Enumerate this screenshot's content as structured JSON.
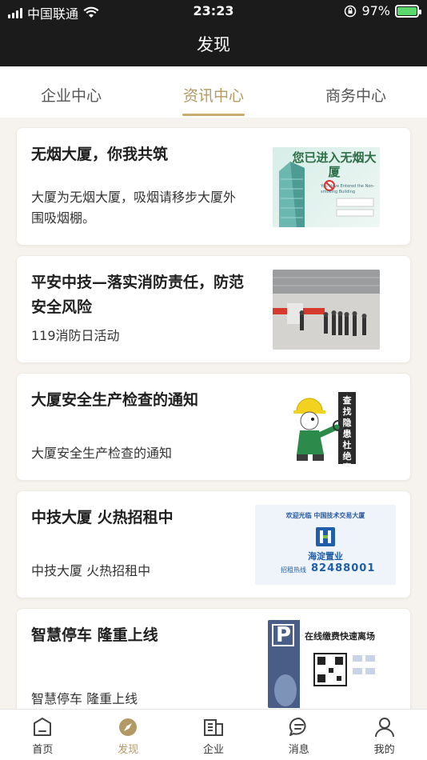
{
  "status": {
    "carrier": "中国联通",
    "time": "23:23",
    "battery_pct": "97%"
  },
  "nav": {
    "title": "发现"
  },
  "tabs": [
    {
      "label": "企业中心",
      "active": false
    },
    {
      "label": "资讯中心",
      "active": true
    },
    {
      "label": "商务中心",
      "active": false
    }
  ],
  "articles": [
    {
      "title": "无烟大厦，你我共筑",
      "desc": "大厦为无烟大厦，吸烟请移步大厦外围吸烟棚。",
      "thumb_text": "您已进入无烟大厦",
      "thumb_sub": "You Have Entered the Non-smoking Building"
    },
    {
      "title": "平安中技—落实消防责任，防范安全风险",
      "desc": "119消防日活动"
    },
    {
      "title": "大厦安全生产检查的通知",
      "desc": "大厦安全生产检查的通知",
      "thumb_text": "查找隐患杜绝事故"
    },
    {
      "title": "中技大厦 火热招租中",
      "desc": "中技大厦 火热招租中",
      "thumb_text": "欢迎光临 中国技术交易大厦",
      "thumb_brand": "海淀置业",
      "thumb_hotline_label": "招租热线",
      "thumb_hotline": "82488001"
    },
    {
      "title": "智慧停车 隆重上线",
      "desc": "智慧停车 隆重上线",
      "thumb_text": "在线缴费快速离场",
      "thumb_letter": "P"
    }
  ],
  "tabbar": [
    {
      "label": "首页",
      "icon": "home-icon",
      "active": false
    },
    {
      "label": "发现",
      "icon": "compass-icon",
      "active": true
    },
    {
      "label": "企业",
      "icon": "building-icon",
      "active": false
    },
    {
      "label": "消息",
      "icon": "message-icon",
      "active": false
    },
    {
      "label": "我的",
      "icon": "user-icon",
      "active": false
    }
  ],
  "colors": {
    "accent": "#b39a64",
    "header_bg": "#1b1b1b",
    "page_bg": "#f6f3ee"
  }
}
